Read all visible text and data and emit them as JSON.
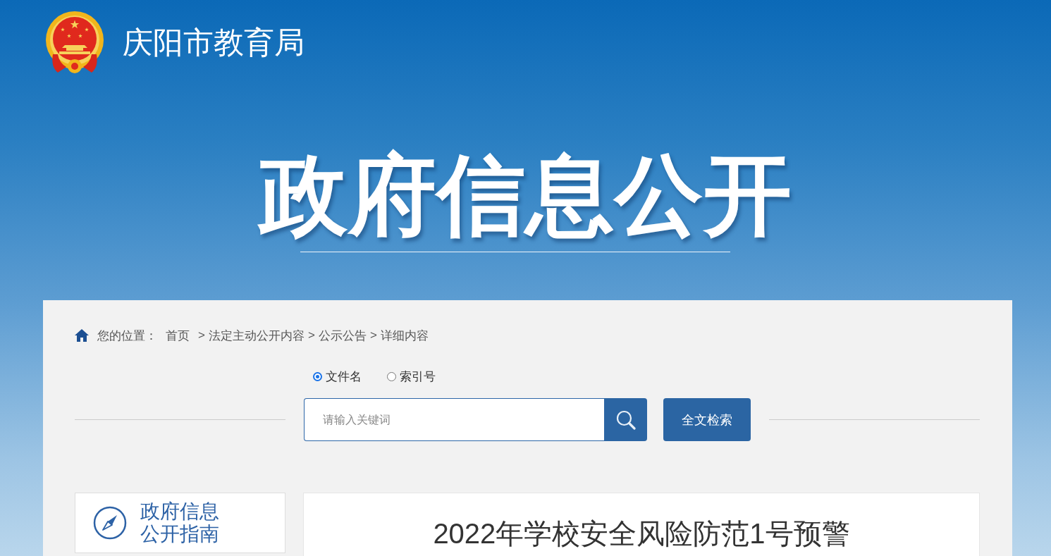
{
  "header": {
    "site_name": "庆阳市教育局"
  },
  "hero": {
    "title": "政府信息公开"
  },
  "breadcrumb": {
    "label": "您的位置：",
    "separator": ">",
    "items": [
      "首页",
      "法定主动公开内容",
      "公示公告",
      "详细内容"
    ]
  },
  "search": {
    "options": [
      {
        "label": "文件名",
        "selected": true
      },
      {
        "label": "索引号",
        "selected": false
      }
    ],
    "placeholder": "请输入关键词",
    "button": "全文检索"
  },
  "sidebar": {
    "items": [
      {
        "label": "政府信息公开指南"
      }
    ]
  },
  "article": {
    "title": "2022年学校安全风险防范1号预警"
  }
}
